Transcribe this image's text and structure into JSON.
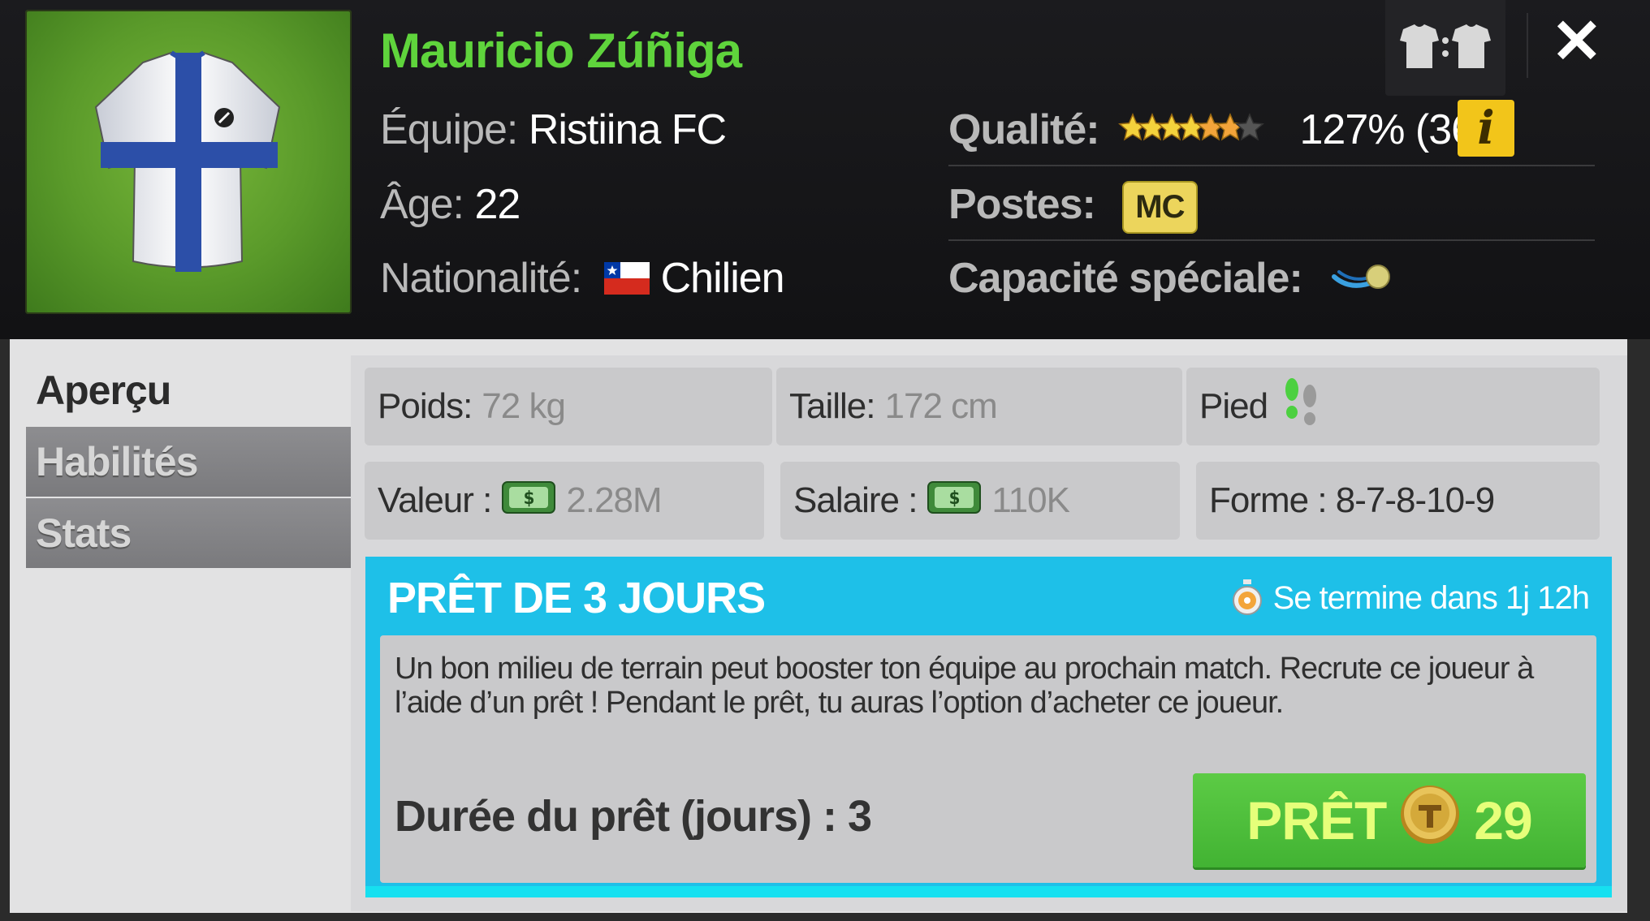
{
  "player": {
    "name": "Mauricio Zúñiga",
    "team_label": "Équipe:",
    "team": "Ristiina FC",
    "age_label": "Âge:",
    "age": "22",
    "nationality_label": "Nationalité:",
    "nationality": "Chilien",
    "quality_label": "Qualité:",
    "quality_value": "127% (36)",
    "stars_filled": 6,
    "stars_total": 7,
    "positions_label": "Postes:",
    "position": "MC",
    "special_label": "Capacité spéciale:",
    "special_icon": "curving-ball-icon"
  },
  "header_buttons": {
    "swap_icon": "shirt-swap-icon",
    "close_label": "✕"
  },
  "tabs": [
    {
      "label": "Aperçu",
      "active": true
    },
    {
      "label": "Habilités",
      "active": false
    },
    {
      "label": "Stats",
      "active": false
    }
  ],
  "stats": {
    "weight_label": "Poids:",
    "weight": "72 kg",
    "height_label": "Taille:",
    "height": "172 cm",
    "foot_label": "Pied",
    "foot_preferred": "left",
    "value_label": "Valeur :",
    "value": "2.28M",
    "salary_label": "Salaire :",
    "salary": "110K",
    "form_label": "Forme : 8-7-8-10-9"
  },
  "loan": {
    "title": "PRÊT DE 3 JOURS",
    "timer": "Se termine dans 1j 12h",
    "description": "Un bon milieu de terrain peut booster ton équipe au prochain match. Recrute ce joueur à l’aide d’un prêt ! Pendant le prêt, tu auras l’option d’acheter ce joueur.",
    "duration": "Durée du prêt (jours) : 3",
    "button_label": "PRÊT",
    "button_cost": "29"
  },
  "colors": {
    "name_green": "#5fd43c",
    "loan_blue": "#1ec0e8",
    "button_green": "#4cbd3a",
    "badge_yellow": "#ecd55c",
    "info_yellow": "#f2c51a"
  }
}
